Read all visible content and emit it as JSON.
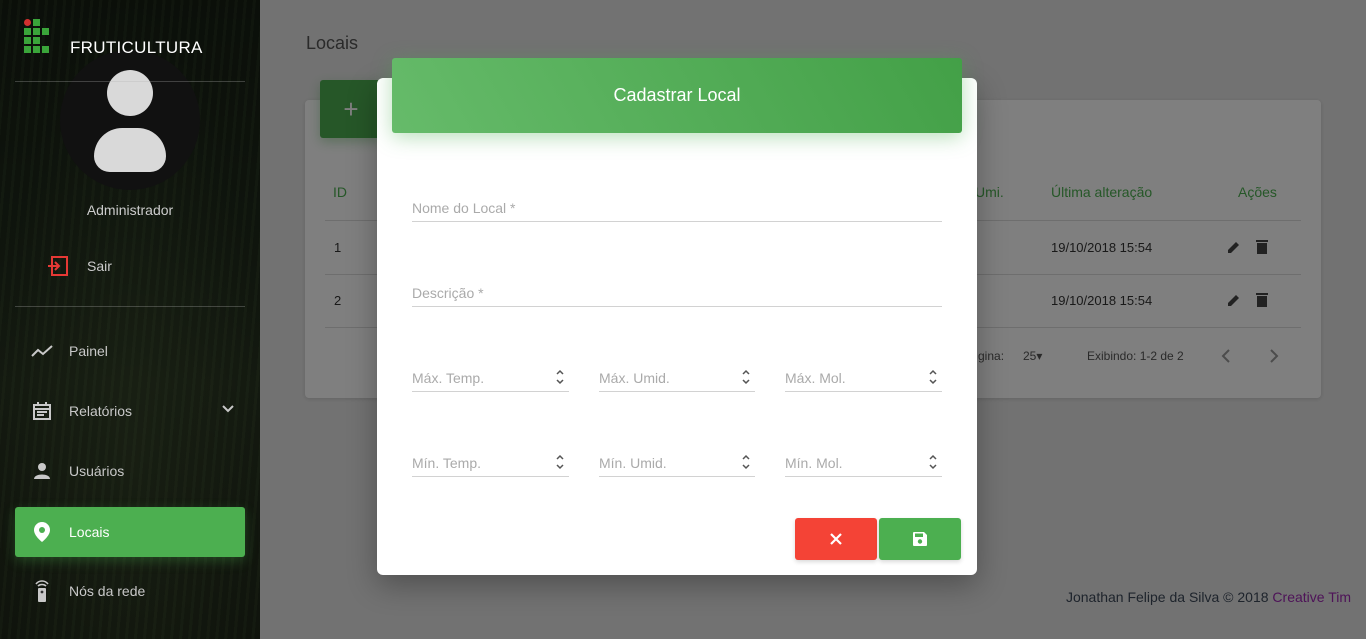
{
  "app": {
    "brand": "FRUTICULTURA"
  },
  "user": {
    "name": "Administrador",
    "logout_label": "Sair"
  },
  "nav": {
    "items": [
      {
        "label": "Painel",
        "icon": "timeline-icon"
      },
      {
        "label": "Relatórios",
        "icon": "calendar-icon"
      },
      {
        "label": "Usuários",
        "icon": "person-icon"
      },
      {
        "label": "Locais",
        "icon": "location-pin-icon",
        "active": true
      },
      {
        "label": "Nós da rede",
        "icon": "router-icon"
      }
    ]
  },
  "page": {
    "title": "Locais",
    "add_label": "+"
  },
  "table": {
    "headers": {
      "id": "ID",
      "umid": "Umi.",
      "updated": "Última alteração",
      "actions": "Ações"
    },
    "rows": [
      {
        "id": "1",
        "updated": "19/10/2018 15:54"
      },
      {
        "id": "2",
        "updated": "19/10/2018 15:54"
      }
    ],
    "pagination": {
      "per_page_label": "gina:",
      "per_page_value": "25",
      "showing": "Exibindo: 1-2 de 2"
    }
  },
  "modal": {
    "title": "Cadastrar Local",
    "fields": {
      "name": "Nome do Local *",
      "description": "Descrição *",
      "max_temp": "Máx. Temp.",
      "max_umid": "Máx. Umid.",
      "max_mol": "Máx. Mol.",
      "min_temp": "Mín. Temp.",
      "min_umid": "Mín. Umid.",
      "min_mol": "Mín. Mol."
    }
  },
  "footer": {
    "text": "Jonathan Felipe da Silva © 2018 ",
    "link": "Creative Tim"
  },
  "colors": {
    "primary": "#4caf50",
    "danger": "#f44336",
    "footer_link": "#9c27b0"
  }
}
